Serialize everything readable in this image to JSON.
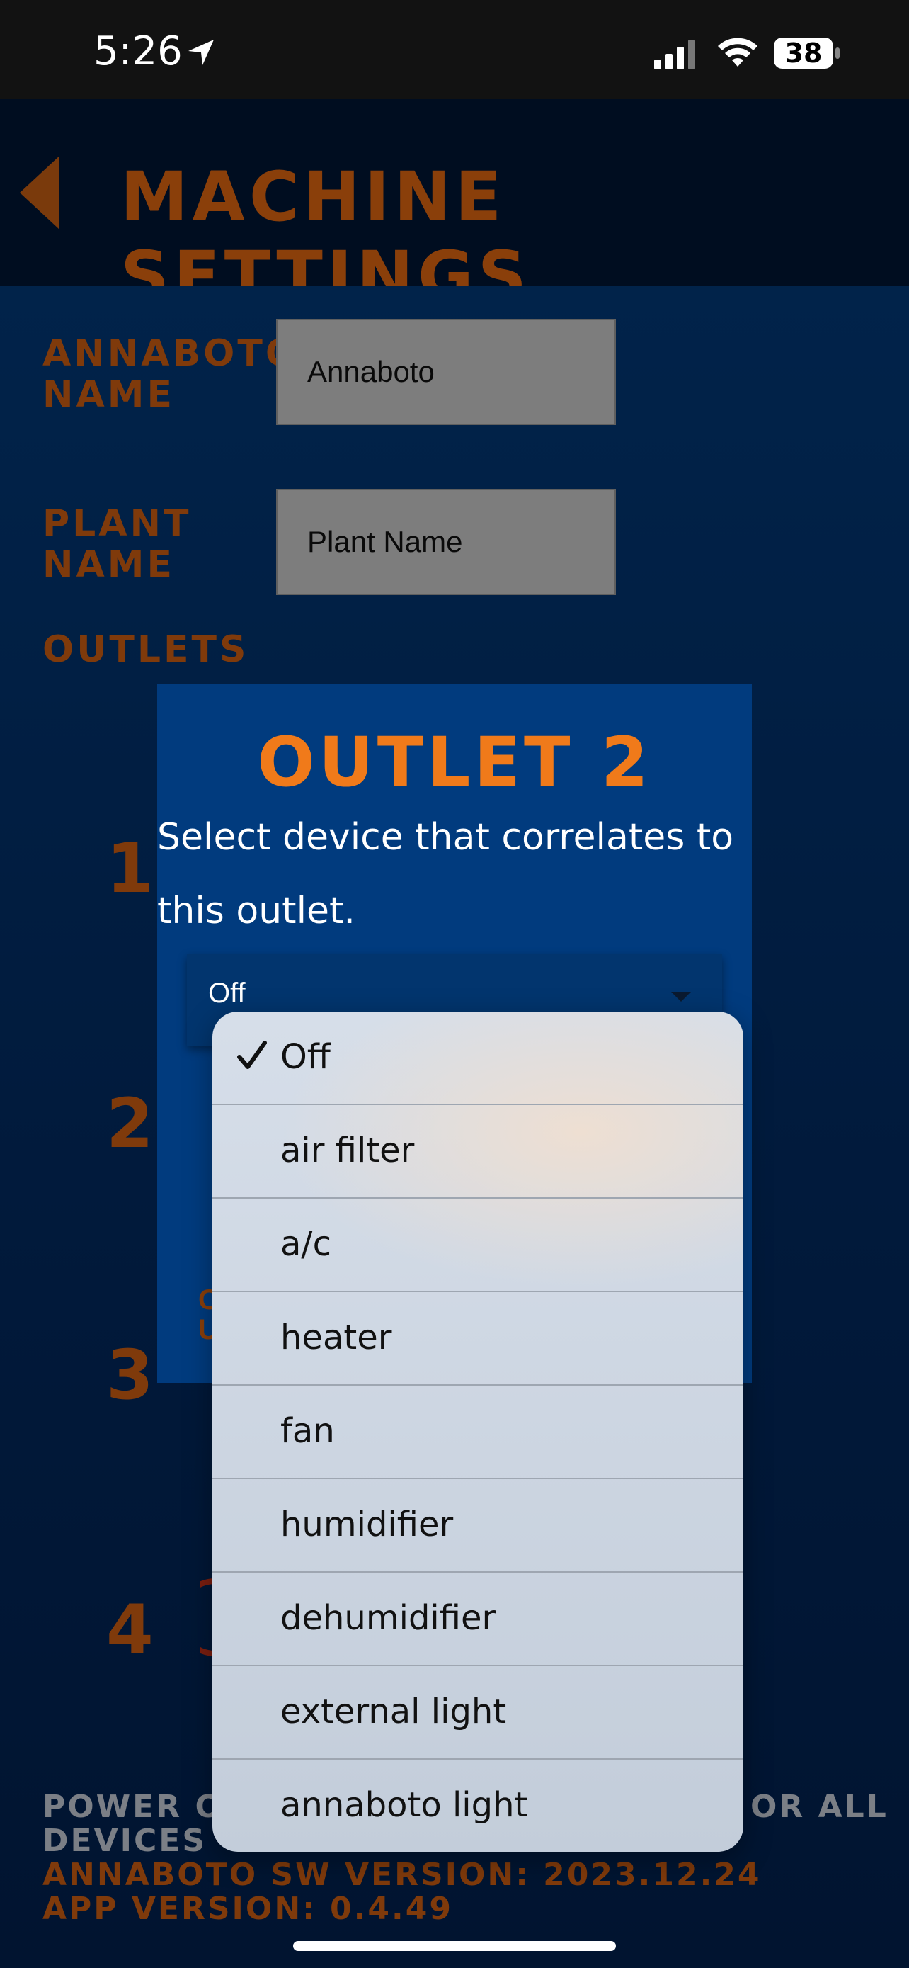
{
  "status_bar": {
    "time": "5:26",
    "battery": "38"
  },
  "header": {
    "title": "MACHINE SETTINGS"
  },
  "form": {
    "annaboto_name_label": [
      "ANNABOTO",
      "NAME"
    ],
    "annaboto_name_value": "Annaboto",
    "plant_name_label": [
      "PLANT",
      "NAME"
    ],
    "plant_name_value": "Plant Name",
    "outlets_label": "OUTLETS",
    "outlet_numbers": [
      "1",
      "2",
      "3",
      "4"
    ]
  },
  "modal": {
    "title": "OUTLET 2",
    "description": "Select device that correlates to this outlet.",
    "select_value": "Off"
  },
  "dropdown": {
    "selected": "Off",
    "options": [
      "Off",
      "air filter",
      "a/c",
      "heater",
      "fan",
      "humidifier",
      "dehumidifier",
      "external light",
      "annaboto light"
    ]
  },
  "footer": {
    "power_line_left": "POWER OU",
    "power_line_right": "OR ALL",
    "power_line_2": "DEVICES",
    "sw_version": "ANNABOTO SW VERSION: 2023.12.24",
    "app_version": "APP VERSION: 0.4.49"
  },
  "colors": {
    "accent": "#f07a1a",
    "modal_bg": "#013b7e",
    "dim_label": "#7f3a0b"
  }
}
